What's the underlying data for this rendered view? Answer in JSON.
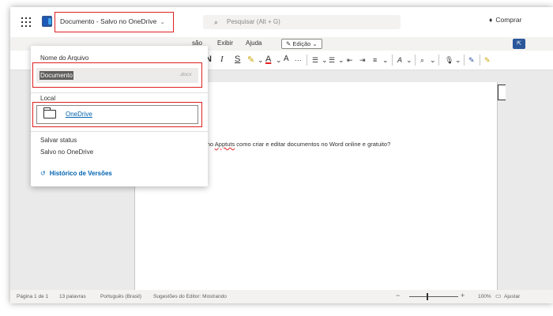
{
  "titlebar": {
    "doc_title": "Documento - Salvo no OneDrive",
    "doc_title_chevron": "⌄",
    "search_placeholder": "Pesquisar (Alt + G)",
    "search_icon": "⌕",
    "buy_label": "Comprar",
    "buy_icon": "♦"
  },
  "ribbon": {
    "tabs": [
      "são",
      "Exibir",
      "Ajuda"
    ],
    "edit_mode_label": "Edição",
    "edit_mode_icon": "✎",
    "edit_mode_chevron": "⌄",
    "toolbar": {
      "bold": "N",
      "italic": "I",
      "underline": "S",
      "highlight": "✎",
      "font_color": "A",
      "clear_format": "A",
      "more": "···",
      "bullets": "☰",
      "numbering": "☰",
      "decrease_indent": "⇤",
      "increase_indent": "⇥",
      "align": "≡",
      "styles": "A",
      "find": "⌕",
      "dictate": "🎙",
      "designer": "✎",
      "editor": "✎",
      "dropdown": "⌄"
    }
  },
  "panel": {
    "filename_label": "Nome do Arquivo",
    "filename_value": "Documento",
    "filename_ext": ".docx",
    "location_label": "Local",
    "location_link": "OneDrive",
    "status_label": "Salvar status",
    "status_value": "Salvo no OneDrive",
    "history_label": "Histórico de Versões",
    "history_icon": "↺"
  },
  "document": {
    "text_before": "ra no ",
    "text_error": "Apptuts",
    "text_after": " como criar e editar documentos no Word online e gratuito?"
  },
  "statusbar": {
    "page": "Página 1 de 1",
    "words": "13 palavras",
    "language": "Português (Brasil)",
    "editor": "Sugestões do Editor: Mostrando",
    "zoom_out": "−",
    "zoom_in": "+",
    "zoom": "100%",
    "fit_icon": "▭",
    "fit": "Ajustar"
  },
  "colors": {
    "highlight_red": "#e02020",
    "word_blue": "#2b579a",
    "link_blue": "#0063b1"
  }
}
